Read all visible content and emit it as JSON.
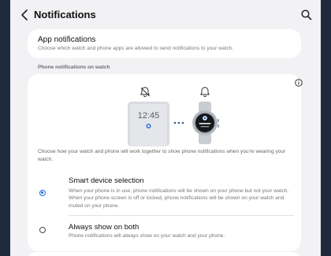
{
  "header": {
    "title": "Notifications"
  },
  "app_notifications": {
    "title": "App notifications",
    "subtitle": "Choose which watch and phone apps are allowed to send notifications to your watch."
  },
  "section": {
    "label": "Phone notifications on watch"
  },
  "illustration": {
    "phone_time": "12:45"
  },
  "description": "Choose how your watch and phone will work together to show phone notifications when you're wearing your watch.",
  "options": [
    {
      "title": "Smart device selection",
      "subtitle": "When your phone is in use, phone notifications will be shown on your phone but not your watch. When your phone screen is off or locked, phone notifications will be shown on your watch and muted on your phone.",
      "selected": true
    },
    {
      "title": "Always show on both",
      "subtitle": "Phone notifications will always show on your watch and your phone.",
      "selected": false
    }
  ],
  "colors": {
    "accent": "#1f6ae0",
    "background": "#f2f2f5",
    "card": "#ffffff"
  },
  "icons": [
    "back-arrow-icon",
    "search-icon",
    "info-icon",
    "bell-off-icon",
    "bell-icon"
  ]
}
